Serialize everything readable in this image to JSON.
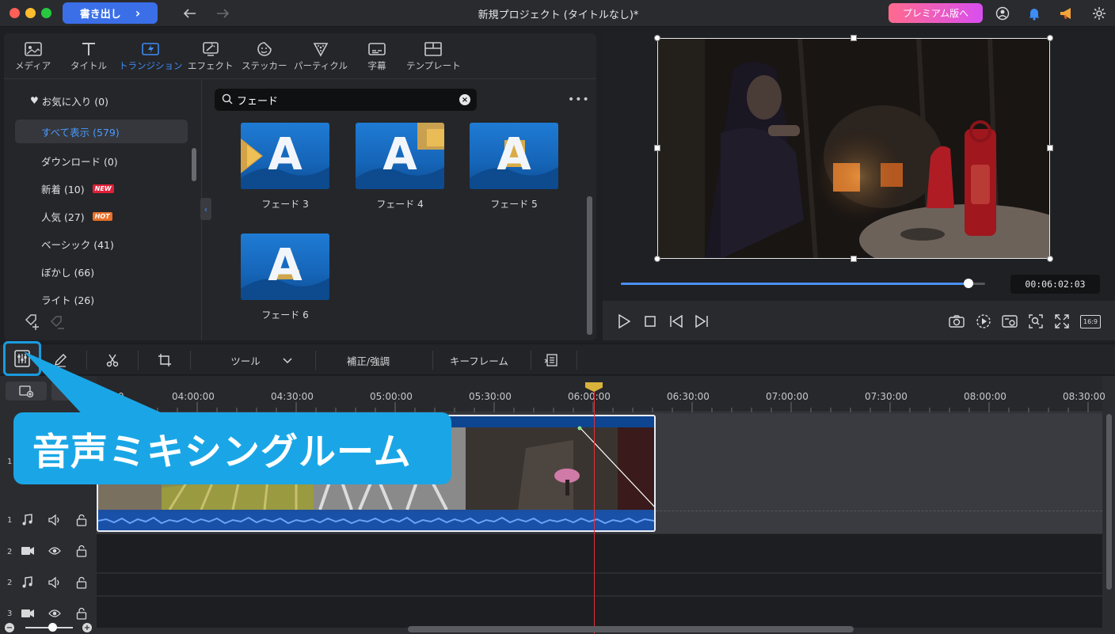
{
  "titlebar": {
    "export_label": "書き出し",
    "window_title": "新規プロジェクト (タイトルなし)*",
    "premium_label": "プレミアム版へ",
    "traffic_colors": [
      "#fe5f57",
      "#febc2e",
      "#28c840"
    ]
  },
  "media_tabs": [
    {
      "label": "メディア",
      "icon": "media-icon"
    },
    {
      "label": "タイトル",
      "icon": "title-icon"
    },
    {
      "label": "トランジション",
      "icon": "transition-icon",
      "active": true
    },
    {
      "label": "エフェクト",
      "icon": "effect-icon"
    },
    {
      "label": "ステッカー",
      "icon": "sticker-icon"
    },
    {
      "label": "パーティクル",
      "icon": "particle-icon"
    },
    {
      "label": "字幕",
      "icon": "subtitle-icon"
    },
    {
      "label": "テンプレート",
      "icon": "template-icon"
    }
  ],
  "sidebar": {
    "items": [
      {
        "label": "お気に入り (0)",
        "icon": "heart-icon"
      },
      {
        "label": "すべて表示 (579)",
        "active": true
      },
      {
        "label": "ダウンロード (0)"
      },
      {
        "label": "新着 (10)",
        "badge": "NEW",
        "badge_color": "#e0203a"
      },
      {
        "label": "人気 (27)",
        "badge": "HOT",
        "badge_color": "#e8702a"
      },
      {
        "label": "ベーシック (41)"
      },
      {
        "label": "ぼかし (66)"
      },
      {
        "label": "ライト (26)"
      }
    ]
  },
  "search": {
    "value": "フェード"
  },
  "transitions": [
    {
      "label": "フェード 3"
    },
    {
      "label": "フェード 4"
    },
    {
      "label": "フェード 5"
    },
    {
      "label": "フェード 6"
    }
  ],
  "preview": {
    "timecode": "00:06:02:03",
    "progress": 0.955,
    "aspect_label": "16:9"
  },
  "toolbar": {
    "tools_label": "ツール",
    "correction_label": "補正/強調",
    "keyframe_label": "キーフレーム"
  },
  "timeline": {
    "ruler_labels": [
      "04:00:00",
      "04:30:00",
      "05:00:00",
      "05:30:00",
      "06:00:00",
      "06:30:00",
      "07:00:00",
      "07:30:00",
      "08:00:00",
      "08:30:00"
    ],
    "ruler_first_partial": "00:00",
    "tracks": [
      {
        "num": "1",
        "type": "video"
      },
      {
        "num": "1",
        "type": "audio"
      },
      {
        "num": "2",
        "type": "video"
      },
      {
        "num": "2",
        "type": "audio"
      },
      {
        "num": "3",
        "type": "video"
      }
    ]
  },
  "callout": {
    "text": "音声ミキシングルーム"
  },
  "colors": {
    "accent": "#3e8cf5",
    "callout": "#1aa6e6",
    "playhead": "#e0313a"
  }
}
